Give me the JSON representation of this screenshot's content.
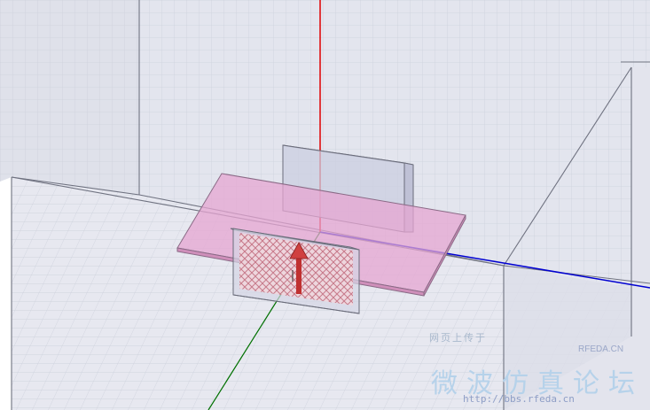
{
  "viewport": {
    "background": "#ffffff",
    "grid_color": "#cfd3de",
    "box_face_color": "#d9dbe8",
    "box_edge_color": "#7a7d8a"
  },
  "axes": {
    "z_color": "#e00000",
    "x_color": "#0000d0",
    "y_color": "#007000"
  },
  "objects": {
    "substrate_color": "#e6a6d2",
    "port_color": "#cc6677",
    "excitation_arrow_color": "#c03030",
    "upper_block_color": "#c4c6dc"
  },
  "watermark": {
    "top_line": "网页上传于",
    "brand": "RFEDA.CN",
    "title": "微波仿真论坛",
    "url": "http://bbs.rfeda.cn"
  }
}
